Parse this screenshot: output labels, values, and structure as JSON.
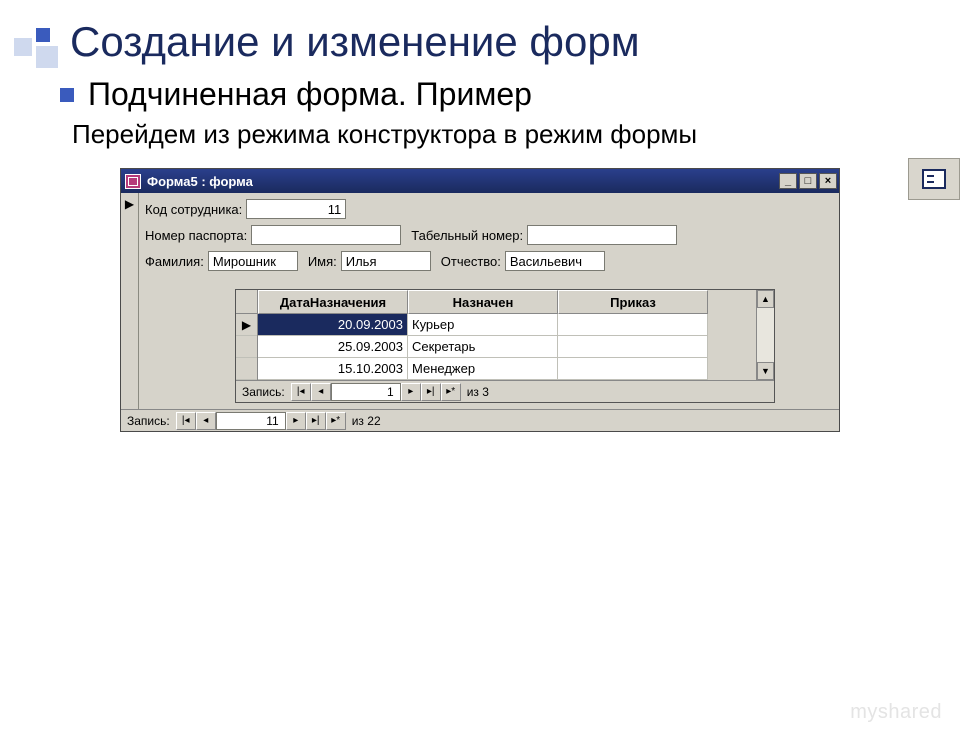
{
  "title": "Создание и изменение форм",
  "bullet": "Подчиненная форма. Пример",
  "subtext": "Перейдем из режима конструктора в режим формы",
  "window": {
    "title": "Форма5 : форма",
    "fields": {
      "emp_code_label": "Код сотрудника:",
      "emp_code_value": "11",
      "passport_label": "Номер паспорта:",
      "passport_value": "",
      "tabel_label": "Табельный номер:",
      "tabel_value": "",
      "lastname_label": "Фамилия:",
      "lastname_value": "Мирошник",
      "firstname_label": "Имя:",
      "firstname_value": "Илья",
      "patronymic_label": "Отчество:",
      "patronymic_value": "Васильевич"
    },
    "subform": {
      "headers": {
        "date": "ДатаНазначения",
        "position": "Назначен",
        "order": "Приказ"
      },
      "rows": [
        {
          "date": "20.09.2003",
          "position": "Курьер",
          "order": ""
        },
        {
          "date": "25.09.2003",
          "position": "Секретарь",
          "order": ""
        },
        {
          "date": "15.10.2003",
          "position": "Менеджер",
          "order": ""
        }
      ],
      "nav": {
        "label": "Запись:",
        "current": "1",
        "of_prefix": "из",
        "total": "3"
      }
    },
    "nav": {
      "label": "Запись:",
      "current": "11",
      "of_prefix": "из",
      "total": "22"
    }
  },
  "watermark": "myshared"
}
